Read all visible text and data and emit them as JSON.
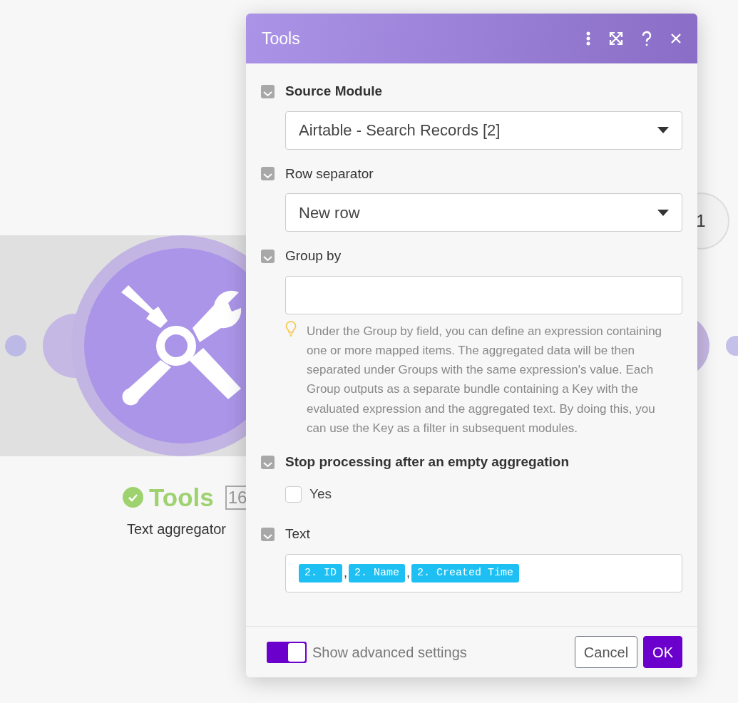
{
  "canvas": {
    "module": {
      "title": "Tools",
      "badge": "16",
      "subtitle": "Text aggregator"
    },
    "bubble": "1"
  },
  "dialog": {
    "title": "Tools",
    "fields": [
      {
        "kind": "select",
        "label": "Source Module",
        "required": true,
        "value": "Airtable - Search Records [2]"
      },
      {
        "kind": "select",
        "label": "Row separator",
        "required": false,
        "value": "New row"
      },
      {
        "kind": "text",
        "label": "Group by",
        "required": false,
        "hint": "Under the Group by field, you can define an expression containing one or more mapped items. The aggregated data will be then separated under Groups with the same expression's value. Each Group outputs as a separate bundle containing a Key with the evaluated expression and the aggregated text. By doing this, you can use the Key as a filter in subsequent modules."
      },
      {
        "kind": "checkbox",
        "label": "Stop processing after an empty aggregation",
        "required": true,
        "option": "Yes",
        "checked": false
      },
      {
        "kind": "tags",
        "label": "Text",
        "required": false,
        "items": [
          {
            "kind": "pill",
            "text": "2. ID"
          },
          {
            "kind": "plain",
            "text": ","
          },
          {
            "kind": "pill",
            "text": "2. Name"
          },
          {
            "kind": "plain",
            "text": ","
          },
          {
            "kind": "pill",
            "text": "2. Created Time"
          }
        ]
      }
    ],
    "footer": {
      "toggle": {
        "label": "Show advanced settings",
        "on": true
      },
      "buttons": [
        {
          "kind": "secondary",
          "label": "Cancel"
        },
        {
          "kind": "primary",
          "label": "OK"
        }
      ]
    }
  }
}
